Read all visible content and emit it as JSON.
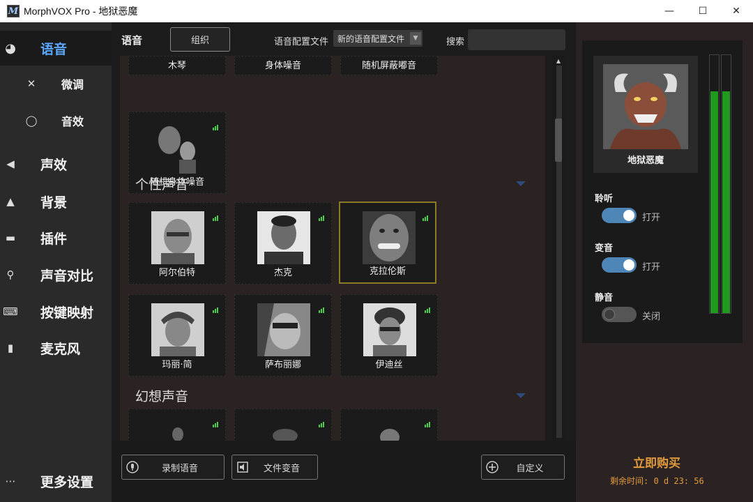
{
  "window": {
    "title": "MorphVOX Pro - 地狱恶魔",
    "app_icon_letter": "M",
    "minimize": "—",
    "maximize": "☐",
    "close": "✕"
  },
  "sidebar": {
    "items": [
      {
        "label": "语音",
        "icon": "voice-globe-icon",
        "glyph": "◕"
      },
      {
        "label": "微调",
        "icon": "wrench-hammer-icon",
        "glyph": "✕"
      },
      {
        "label": "音效",
        "icon": "lips-icon",
        "glyph": "◯"
      },
      {
        "label": "声效",
        "icon": "speaker-icon",
        "glyph": "◀"
      },
      {
        "label": "背景",
        "icon": "mountain-icon",
        "glyph": "▲"
      },
      {
        "label": "插件",
        "icon": "plugin-icon",
        "glyph": "▬"
      },
      {
        "label": "声音对比",
        "icon": "magnifier-icon",
        "glyph": "⚲"
      },
      {
        "label": "按键映射",
        "icon": "keyboard-keys-icon",
        "glyph": "⌨"
      },
      {
        "label": "麦克风",
        "icon": "microphone-icon",
        "glyph": "▮"
      },
      {
        "label": "更多设置",
        "icon": "more-dots-icon",
        "glyph": "⋯"
      }
    ]
  },
  "main": {
    "section_title": "语音",
    "organize_label": "组织",
    "profile_label": "语音配置文件",
    "profile_value": "新的语音配置文件",
    "search_label": "搜索",
    "search_value": "",
    "top_row": [
      {
        "name": "木琴"
      },
      {
        "name": "身体噪音"
      },
      {
        "name": "随机屏蔽嘟音"
      }
    ],
    "single_card": {
      "name": "随机身体噪音"
    },
    "categories": [
      "个性声音",
      "幻想声音"
    ],
    "personality_voices": [
      {
        "name": "阿尔伯特"
      },
      {
        "name": "杰克"
      },
      {
        "name": "克拉伦斯"
      },
      {
        "name": "玛丽·简"
      },
      {
        "name": "萨布丽娜"
      },
      {
        "name": "伊迪丝"
      }
    ],
    "selected_voice": "克拉伦斯",
    "fantasy_voices": [
      {
        "name": ""
      },
      {
        "name": ""
      },
      {
        "name": ""
      }
    ],
    "bottom_buttons": {
      "record": "录制语音",
      "file_convert": "文件变音",
      "custom": "自定义"
    }
  },
  "right_panel": {
    "current_voice": "地狱恶魔",
    "listen_label": "聆听",
    "listen_state": "打开",
    "listen_on": true,
    "morph_label": "变音",
    "morph_state": "打开",
    "morph_on": true,
    "mute_label": "静音",
    "mute_state": "关闭",
    "mute_on": false,
    "meter_levels": [
      0.86,
      0.86
    ],
    "buy_label": "立即购买",
    "remaining_label": "剩余时间: 0 d 23: 56"
  },
  "colors": {
    "accent_blue": "#5aa9ff",
    "toggle_on": "#4f86b8",
    "meter_green": "#1f9a1f",
    "buy_orange": "#e29a3c",
    "selected_border": "#8a7d2a"
  }
}
